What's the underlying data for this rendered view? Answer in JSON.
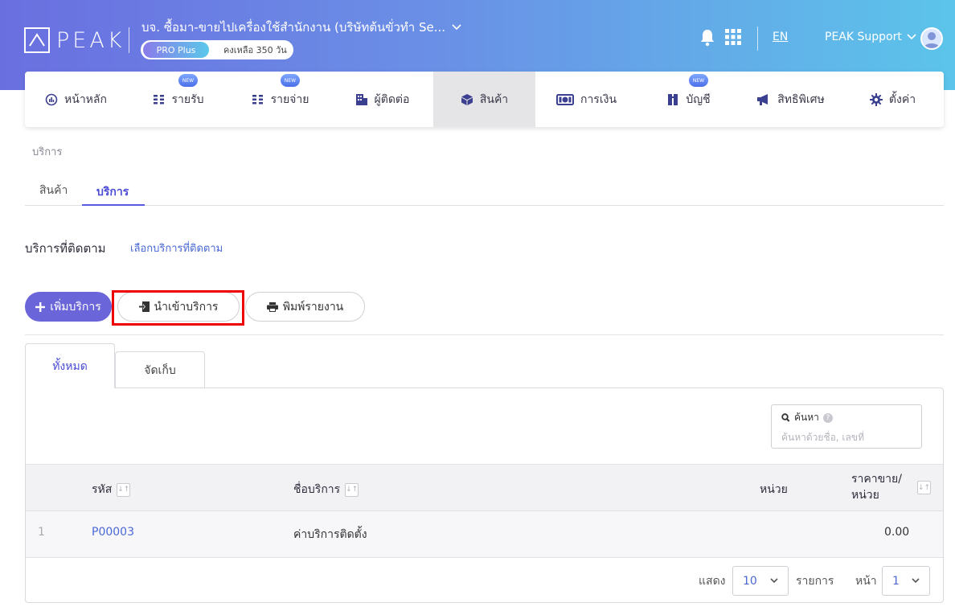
{
  "header": {
    "logo_text": "PEAK",
    "company_name": "บจ. ซื้อมา-ขายไปเครื่องใช้สำนักงาน (บริษัทต้นขั่วทำ Se...",
    "plan_name": "PRO Plus",
    "plan_remaining": "คงเหลือ 350 วัน",
    "language": "EN",
    "user_name": "PEAK Support"
  },
  "nav": {
    "items": [
      {
        "label": "หน้าหลัก",
        "icon": "dashboard-icon",
        "badge": ""
      },
      {
        "label": "รายรับ",
        "icon": "income-icon",
        "badge": "NEW"
      },
      {
        "label": "รายจ่าย",
        "icon": "expense-icon",
        "badge": "NEW"
      },
      {
        "label": "ผู้ติดต่อ",
        "icon": "contacts-icon",
        "badge": ""
      },
      {
        "label": "สินค้า",
        "icon": "product-box-icon",
        "badge": ""
      },
      {
        "label": "การเงิน",
        "icon": "money-icon",
        "badge": ""
      },
      {
        "label": "บัญชี",
        "icon": "ledger-icon",
        "badge": "NEW"
      },
      {
        "label": "สิทธิพิเศษ",
        "icon": "megaphone-icon",
        "badge": ""
      },
      {
        "label": "ตั้งค่า",
        "icon": "gear-icon",
        "badge": ""
      }
    ],
    "active_index": 4
  },
  "breadcrumb": "บริการ",
  "subtabs": {
    "products": "สินค้า",
    "services": "บริการ"
  },
  "section": {
    "title": "บริการที่ติดตาม",
    "link": "เลือกบริการที่ติดตาม"
  },
  "actions": {
    "add": "เพิ่มบริการ",
    "import": "นำเข้าบริการ",
    "print": "พิมพ์รายงาน"
  },
  "list_tabs": {
    "all": "ทั้งหมด",
    "archived": "จัดเก็บ"
  },
  "search": {
    "label": "ค้นหา",
    "placeholder": "ค้นหาด้วยชื่อ, เลขที่"
  },
  "table": {
    "headers": {
      "code": "รหัส",
      "name": "ชื่อบริการ",
      "unit": "หน่วย",
      "price_line1": "ราคาขาย/",
      "price_line2": "หน่วย"
    },
    "rows": [
      {
        "index": "1",
        "code": "P00003",
        "name": "ค่าบริการติดตั้ง",
        "unit": "",
        "price": "0.00"
      }
    ]
  },
  "pagination": {
    "show_label": "แสดง",
    "page_size": "10",
    "items_label": "รายการ",
    "page_label": "หน้า",
    "page": "1"
  },
  "colors": {
    "accent": "#6b65da",
    "link": "#4a68d6",
    "highlight": "#e00000"
  }
}
